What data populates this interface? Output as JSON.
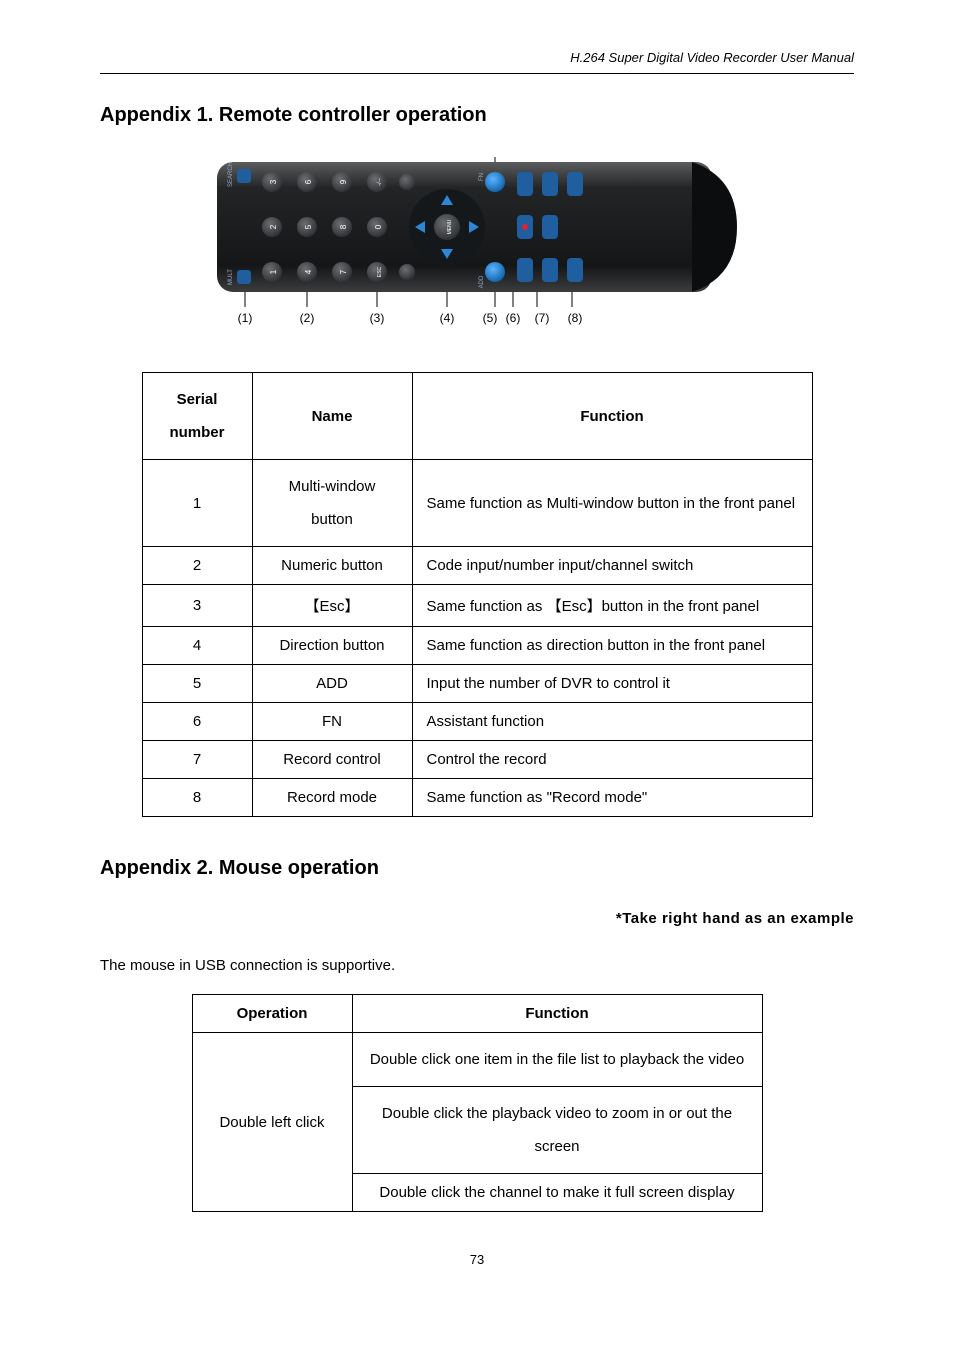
{
  "header": "H.264 Super Digital Video Recorder User Manual",
  "appendix1": {
    "title": "Appendix 1. Remote controller operation",
    "callouts": [
      "(1)",
      "(2)",
      "(3)",
      "(4)",
      "(5)",
      "(6)",
      "(7)",
      "(8)"
    ],
    "table": {
      "headers": {
        "serial": "Serial number",
        "name": "Name",
        "function": "Function"
      },
      "rows": [
        {
          "serial": "1",
          "name": "Multi-window button",
          "function": "Same function as Multi-window button in the front panel"
        },
        {
          "serial": "2",
          "name": "Numeric button",
          "function": "Code input/number input/channel switch"
        },
        {
          "serial": "3",
          "name": "【Esc】",
          "function": "Same function as 【Esc】button in the front panel"
        },
        {
          "serial": "4",
          "name": "Direction button",
          "function": "Same function as direction button in the front panel"
        },
        {
          "serial": "5",
          "name": "ADD",
          "function": "Input the number of DVR to control it"
        },
        {
          "serial": "6",
          "name": "FN",
          "function": "Assistant function"
        },
        {
          "serial": "7",
          "name": "Record control",
          "function": "Control the record"
        },
        {
          "serial": "8",
          "name": "Record mode",
          "function": "Same function as \"Record mode\""
        }
      ]
    }
  },
  "appendix2": {
    "title": "Appendix 2. Mouse operation",
    "note": "*Take right hand as an example",
    "body": "The mouse in USB connection is supportive.",
    "table": {
      "headers": {
        "operation": "Operation",
        "function": "Function"
      },
      "rows": [
        {
          "operation": "Double left click",
          "functions": [
            "Double click one item in the file list to playback the video",
            "Double click the playback video to zoom in or out the screen",
            "Double click the channel to make it full screen display"
          ]
        }
      ]
    }
  },
  "page_number": "73",
  "remote_labels": {
    "search": "SEARCH",
    "mult": "MULT",
    "fn": "FN",
    "add": "ADD",
    "menu": "MENU",
    "esc": "ESC",
    "numbers": [
      "1",
      "2",
      "3",
      "4",
      "5",
      "6",
      "7",
      "8",
      "9",
      "0",
      "-/--"
    ]
  }
}
